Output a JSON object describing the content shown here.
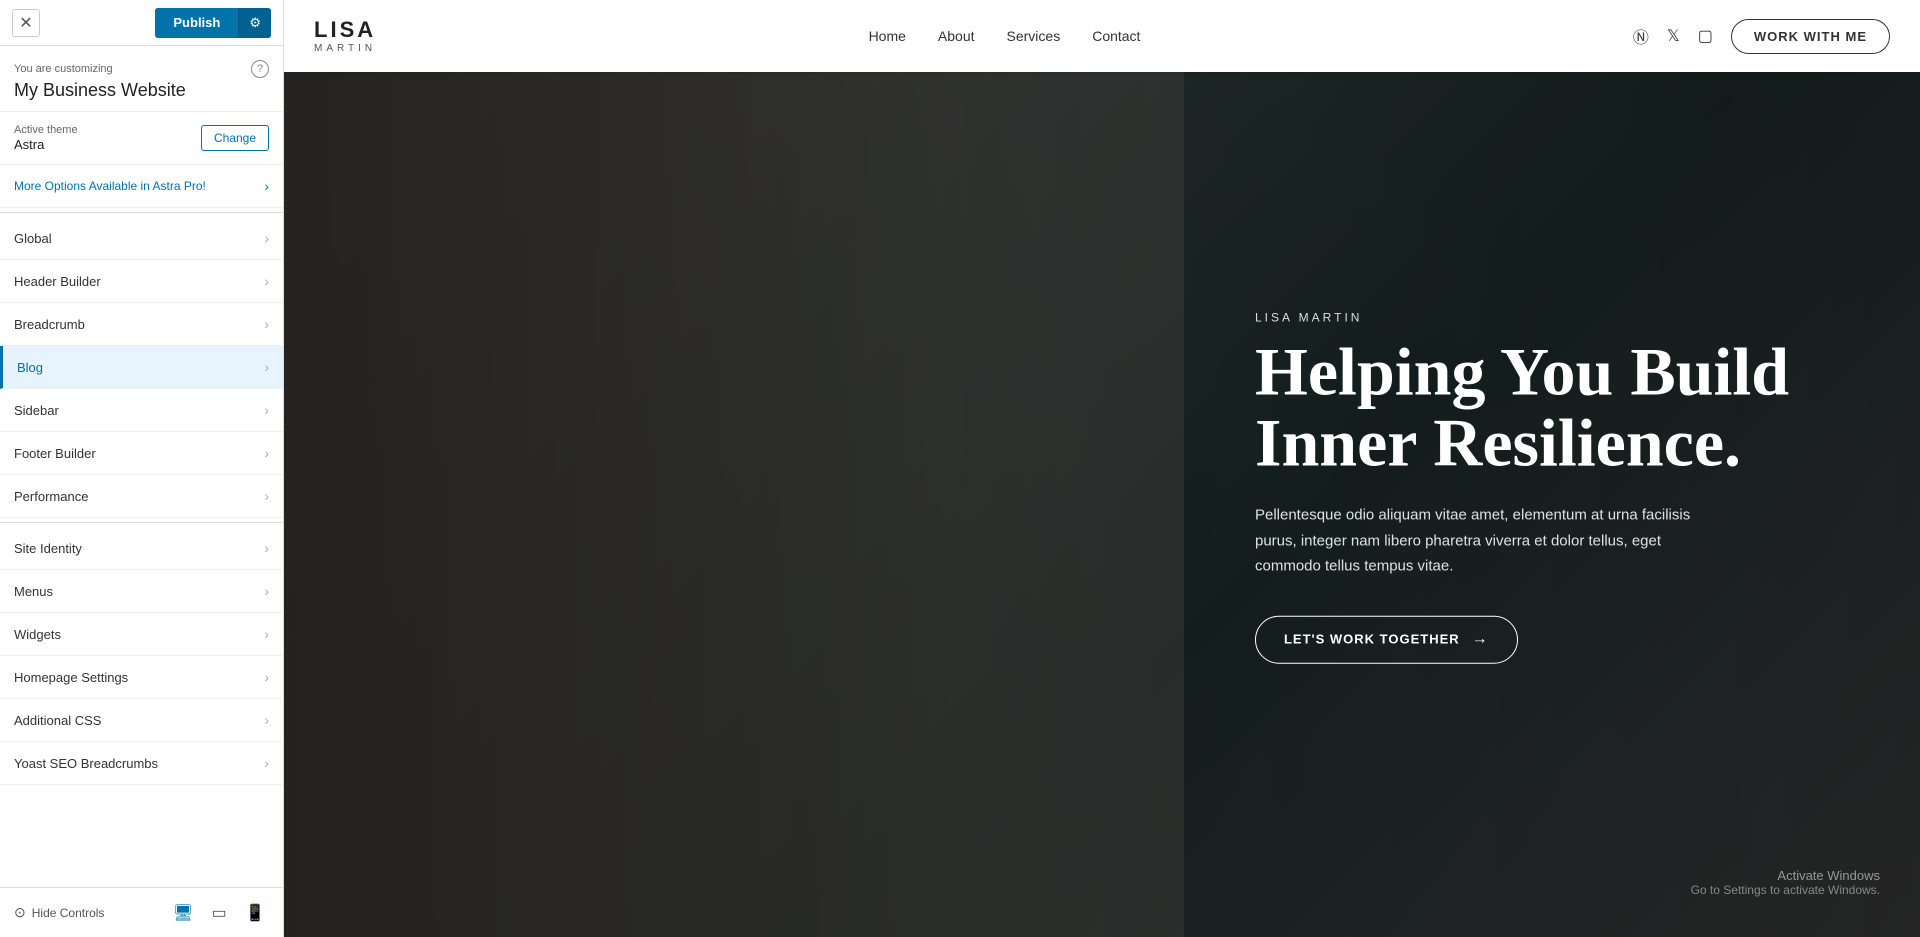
{
  "topbar": {
    "close_label": "✕",
    "publish_label": "Publish",
    "gear_label": "⚙"
  },
  "customizing": {
    "label": "You are customizing",
    "site_name": "My Business Website",
    "help": "?"
  },
  "active_theme": {
    "label": "Active theme",
    "theme_name": "Astra",
    "change_label": "Change"
  },
  "menu": {
    "promo_item": "More Options Available in Astra Pro!",
    "items": [
      {
        "id": "global",
        "label": "Global",
        "active": false
      },
      {
        "id": "header-builder",
        "label": "Header Builder",
        "active": false
      },
      {
        "id": "breadcrumb",
        "label": "Breadcrumb",
        "active": false
      },
      {
        "id": "blog",
        "label": "Blog",
        "active": true
      },
      {
        "id": "sidebar",
        "label": "Sidebar",
        "active": false
      },
      {
        "id": "footer-builder",
        "label": "Footer Builder",
        "active": false
      },
      {
        "id": "performance",
        "label": "Performance",
        "active": false
      },
      {
        "id": "site-identity",
        "label": "Site Identity",
        "active": false
      },
      {
        "id": "menus",
        "label": "Menus",
        "active": false
      },
      {
        "id": "widgets",
        "label": "Widgets",
        "active": false
      },
      {
        "id": "homepage-settings",
        "label": "Homepage Settings",
        "active": false
      },
      {
        "id": "additional-css",
        "label": "Additional CSS",
        "active": false
      },
      {
        "id": "yoast-seo",
        "label": "Yoast SEO Breadcrumbs",
        "active": false
      }
    ]
  },
  "bottom_bar": {
    "hide_controls_label": "Hide Controls"
  },
  "website": {
    "logo_name": "LISA",
    "logo_sub": "MARTIN",
    "nav": [
      "Home",
      "About",
      "Services",
      "Contact"
    ],
    "work_with_me": "WORK WITH ME",
    "hero_author": "LISA MARTIN",
    "hero_headline_line1": "Helping You Build",
    "hero_headline_line2": "Inner Resilience.",
    "hero_subtext": "Pellentesque odio aliquam vitae amet, elementum at urna facilisis purus, integer nam libero pharetra viverra et dolor tellus, eget commodo tellus tempus vitae.",
    "cta_label": "LET'S WORK TOGETHER",
    "cta_arrow": "→",
    "activate_title": "Activate Windows",
    "activate_sub": "Go to Settings to activate Windows."
  }
}
